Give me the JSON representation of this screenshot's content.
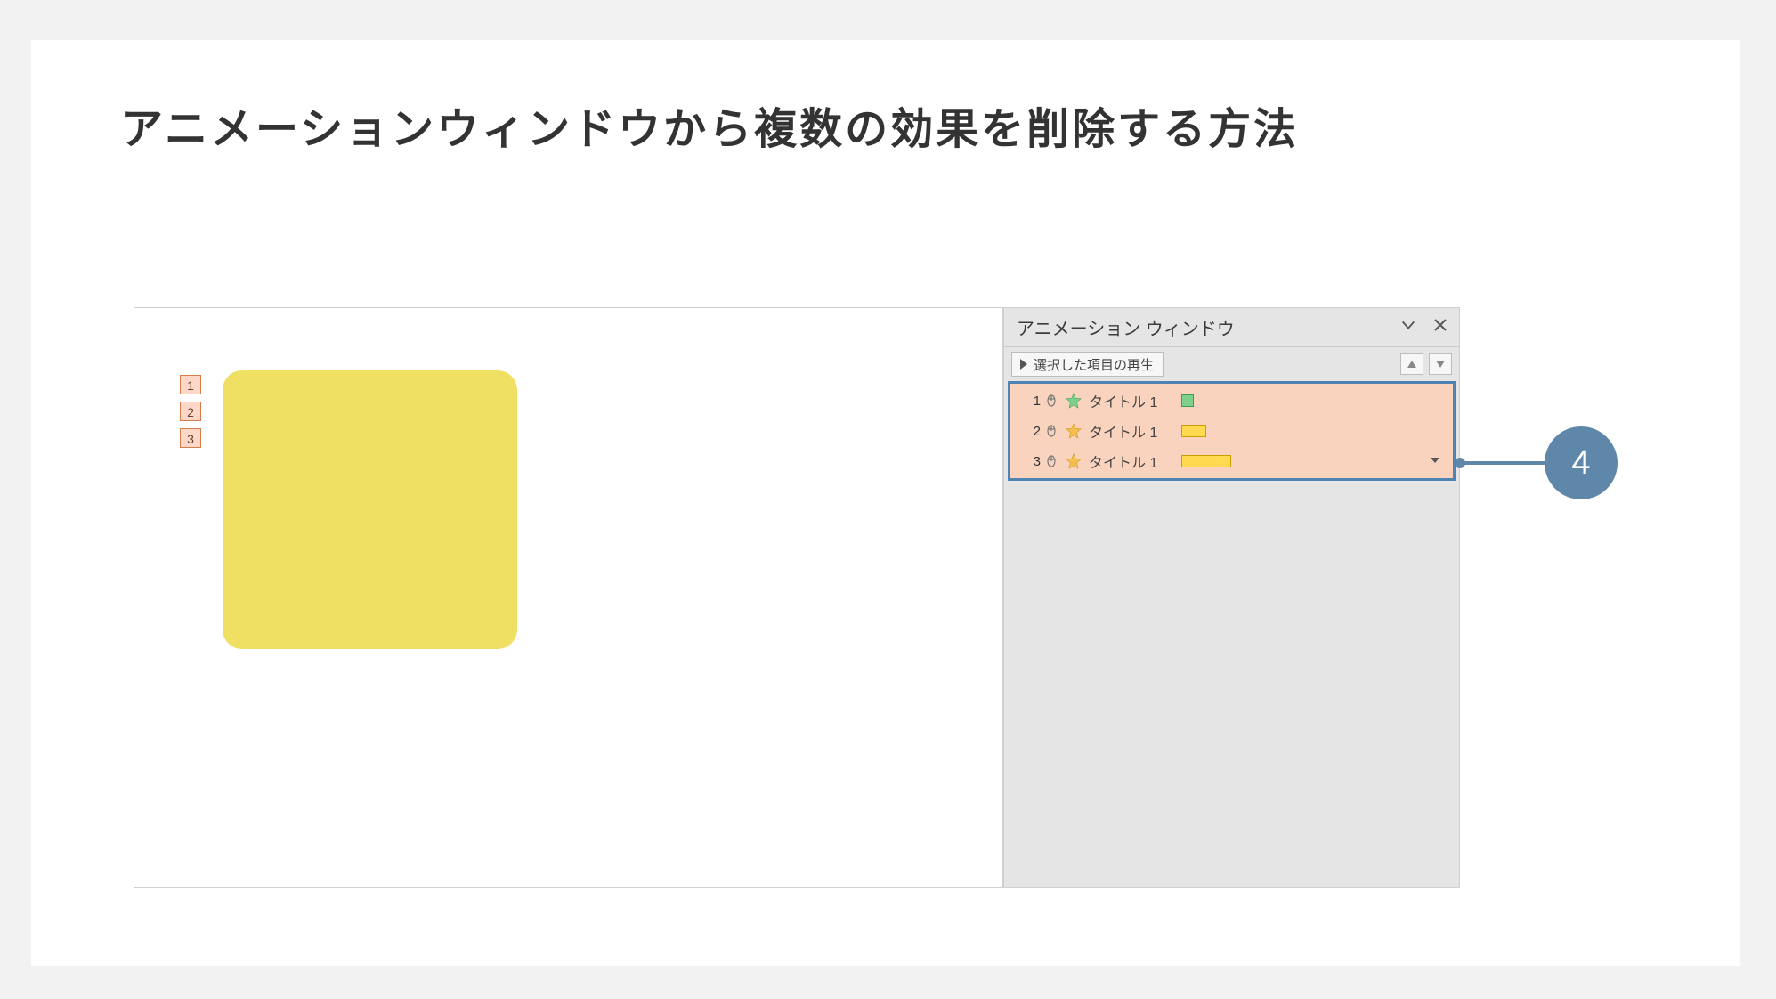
{
  "page": {
    "title": "アニメーションウィンドウから複数の効果を削除する方法"
  },
  "slide": {
    "tags": [
      "1",
      "2",
      "3"
    ]
  },
  "pane": {
    "title": "アニメーション ウィンドウ",
    "play_button": "選択した項目の再生",
    "items": [
      {
        "num": "1",
        "label": "タイトル 1",
        "star_color": "#7ed08a"
      },
      {
        "num": "2",
        "label": "タイトル 1",
        "star_color": "#f4c04d"
      },
      {
        "num": "3",
        "label": "タイトル 1",
        "star_color": "#f4c04d"
      }
    ]
  },
  "callout": {
    "number": "4"
  },
  "colors": {
    "highlight_border": "#4e84b4",
    "highlight_fill": "#f9d3bd",
    "callout": "#5f87aa"
  }
}
